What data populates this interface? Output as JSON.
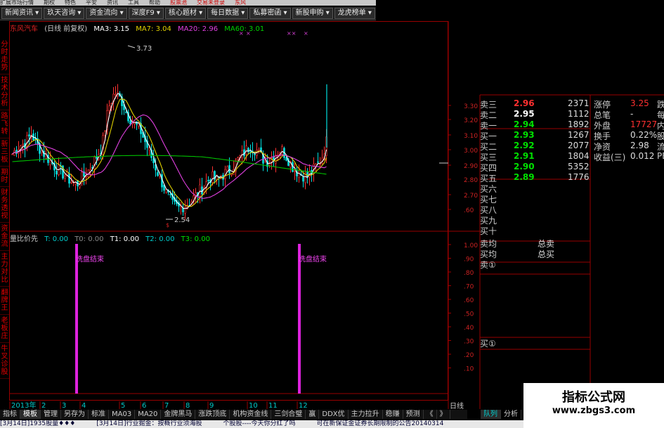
{
  "menu": [
    "扩展市场行情",
    "期权",
    "特色",
    "平安",
    "资讯",
    "工具",
    "帮助"
  ],
  "menu_tail": [
    "股票池",
    "交易未登录",
    "东风"
  ],
  "nav": [
    "新闻资讯",
    "玖天咨询",
    "资金流向",
    "深度F9",
    "核心题材",
    "每日数据",
    "私募密函",
    "新股申购",
    "龙虎榜单"
  ],
  "left_tabs": [
    "分时走势",
    "技术分析",
    "路飞转",
    "新三板",
    "期时",
    "财务透视",
    "资金流",
    "主力对比",
    "翻牌王",
    "老板庄",
    "牛叉诊股"
  ],
  "title": {
    "name": "东风汽车",
    "type": "(日线 前复权)",
    "ma3": "MA3: 3.15",
    "ma7": "MA7: 3.04",
    "ma20": "MA20: 2.96",
    "ma60": "MA60: 3.01"
  },
  "annotations": {
    "high": "3.73",
    "low": "2.54"
  },
  "indicator": {
    "name": "量比价先",
    "t": "T: 0.00",
    "t0": "T0: 0.00",
    "t1": "T1: 0.00",
    "t2": "T2: 0.00",
    "t3": "T3: 0.00",
    "label1": "洗盘结束",
    "label2": "洗盘结束"
  },
  "price_axis": [
    "3.30",
    "3.20",
    "3.10",
    "3.00",
    "2.90",
    "2.80",
    "2.70",
    ".60"
  ],
  "ind_axis": [
    "1.00",
    ".90",
    ".80",
    ".70",
    ".60",
    ".50",
    ".40",
    ".30",
    ".20",
    ".10"
  ],
  "asks": [
    {
      "label": "卖三",
      "price": "2.96",
      "vol": "2371"
    },
    {
      "label": "卖二",
      "price": "2.95",
      "vol": "1112"
    },
    {
      "label": "卖一",
      "price": "2.94",
      "vol": "1892"
    }
  ],
  "bids": [
    {
      "label": "买一",
      "price": "2.93",
      "vol": "1267"
    },
    {
      "label": "买二",
      "price": "2.92",
      "vol": "2077"
    },
    {
      "label": "买三",
      "price": "2.91",
      "vol": "1804"
    },
    {
      "label": "买四",
      "price": "2.90",
      "vol": "5352"
    },
    {
      "label": "买五",
      "price": "2.89",
      "vol": "1776"
    },
    {
      "label": "买六",
      "price": "",
      "vol": ""
    },
    {
      "label": "买七",
      "price": "",
      "vol": ""
    },
    {
      "label": "买八",
      "price": "",
      "vol": ""
    },
    {
      "label": "买九",
      "price": "",
      "vol": ""
    },
    {
      "label": "买十",
      "price": "",
      "vol": ""
    }
  ],
  "avg": {
    "sell_avg": "卖均",
    "buy_avg": "买均",
    "total_sell": "总卖",
    "total_buy": "总买",
    "sell1": "卖①",
    "buy1": "买①"
  },
  "stats": [
    {
      "label": "涨停",
      "value": "3.25",
      "extra": "跌"
    },
    {
      "label": "总笔",
      "value": "-",
      "extra": "每"
    },
    {
      "label": "外盘",
      "value": "17727",
      "extra": "内"
    },
    {
      "label": "换手",
      "value": "0.22%",
      "extra": "股"
    },
    {
      "label": "净资",
      "value": "2.98",
      "extra": "流"
    },
    {
      "label": "收益(三)",
      "value": "0.012",
      "extra": "PE"
    }
  ],
  "time_axis": [
    "2013年",
    "2",
    "3",
    "4",
    "5",
    "6",
    "7",
    "8",
    "9",
    "10",
    "11",
    "12"
  ],
  "bottom_tabs": [
    "指标",
    "模板",
    "管理",
    "另存为",
    "标准",
    "MA03",
    "MA20",
    "金牌黑马",
    "涨跌顶底",
    "机构资金线",
    "三剑合璧",
    "赢",
    "DDX优",
    "主力拉升",
    "稳赚",
    "预测",
    "《",
    "》"
  ],
  "right_tabs": [
    "日线",
    "队列",
    "分析"
  ],
  "ticker": [
    "[3月14日]1935股量♦♦♦",
    "[3月14日]行业掘金：按概行业须海股",
    "个股股----今天你分红了吗",
    "可在新保证金证券长期限制的公告20140314"
  ],
  "watermark": {
    "line1": "指标公式网",
    "line2": "www.zbgs3.com"
  },
  "colors": {
    "up": "#ff3030",
    "down": "#00e000",
    "ma3": "#ffffff",
    "ma7": "#e0d000",
    "ma20": "#e040e0",
    "ma60": "#00d000",
    "cyan": "#00c8c8",
    "frame": "#990000",
    "magenta": "#dd22dd"
  }
}
